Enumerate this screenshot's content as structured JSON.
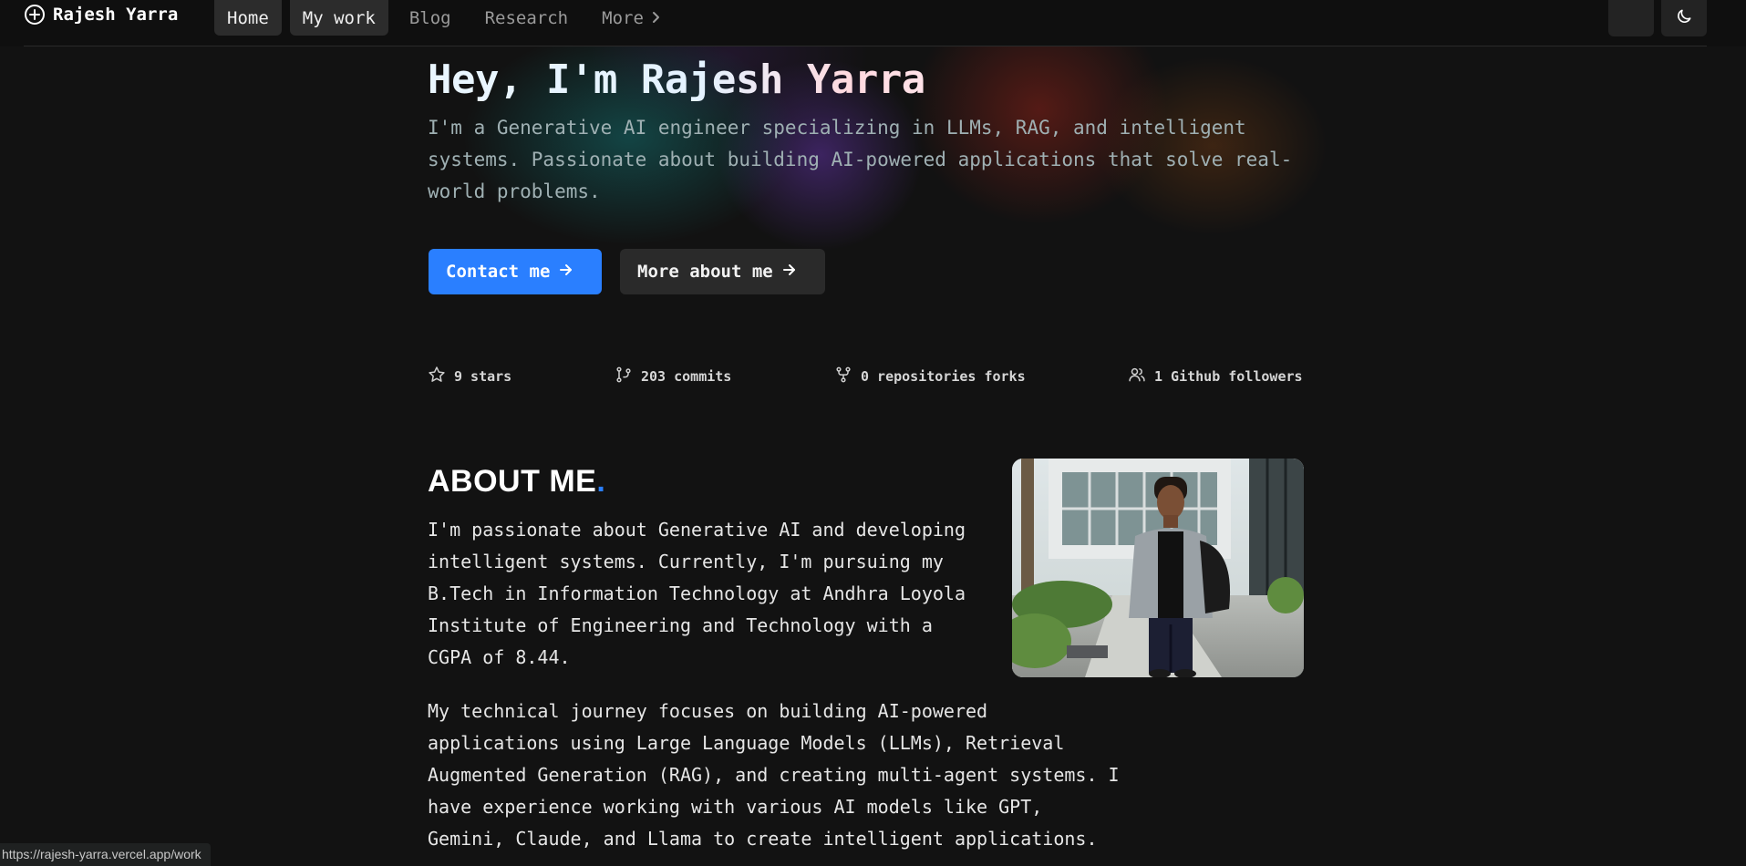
{
  "nav": {
    "brand": "Rajesh Yarra",
    "links": [
      {
        "label": "Home"
      },
      {
        "label": "My work"
      },
      {
        "label": "Blog"
      },
      {
        "label": "Research"
      },
      {
        "label": "More"
      }
    ],
    "icons": [
      "plus-circle-icon",
      "chevron-right-icon",
      "moon-icon"
    ]
  },
  "hero": {
    "title": "Hey, I'm Rajesh Yarra",
    "subtitle": "I'm a Generative AI engineer specializing in LLMs, RAG, and intelligent systems. Passionate about building AI-powered applications that solve real-world problems.",
    "contact_label": "Contact me",
    "more_label": "More about me"
  },
  "stats": [
    {
      "icon": "star-icon",
      "label": "9 stars"
    },
    {
      "icon": "git-commit-icon",
      "label": "203 commits"
    },
    {
      "icon": "git-fork-icon",
      "label": "0 repositories forks"
    },
    {
      "icon": "users-icon",
      "label": "1 Github followers"
    }
  ],
  "about": {
    "title": "ABOUT ME",
    "title_dot": ".",
    "p1": "I'm passionate about Generative AI and developing intelligent systems. Currently, I'm pursuing my B.Tech in Information Technology at Andhra Loyola Institute of Engineering and Technology with a CGPA of 8.44.",
    "p2": "My technical journey focuses on building AI-powered applications using Large Language Models (LLMs), Retrieval Augmented Generation (RAG), and creating multi-agent systems. I have experience working with various AI models like GPT, Gemini, Claude, and Llama to create intelligent applications."
  },
  "status_bar": {
    "url": "https://rajesh-yarra.vercel.app/work"
  },
  "colors": {
    "background": "#121212",
    "accent": "#2a7fff",
    "secondary_button": "#2a2a2a"
  }
}
